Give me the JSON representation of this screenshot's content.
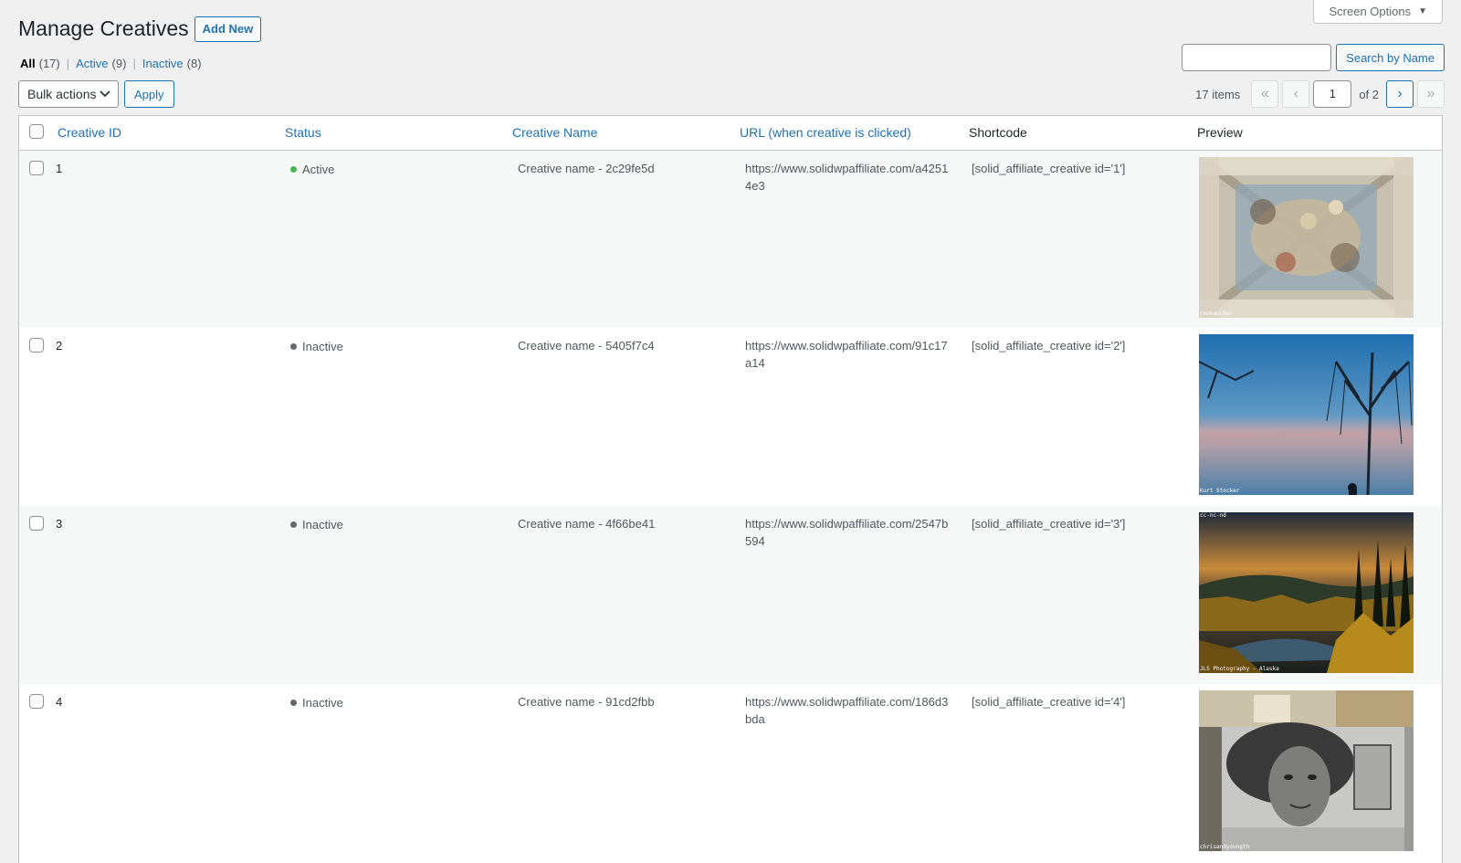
{
  "header": {
    "title": "Manage Creatives",
    "add_new": "Add New",
    "screen_options": "Screen Options",
    "screen_options_arrow": "▼"
  },
  "filters": {
    "all": {
      "label": "All",
      "count": "(17)"
    },
    "active": {
      "label": "Active",
      "count": "(9)"
    },
    "inactive": {
      "label": "Inactive",
      "count": "(8)"
    },
    "separator": "|"
  },
  "search": {
    "value": "",
    "button": "Search by Name"
  },
  "bulk": {
    "selected": "Bulk actions",
    "apply": "Apply"
  },
  "pagination": {
    "items": "17 items",
    "first": "«",
    "prev": "‹",
    "current": "1",
    "of": "of 2",
    "next": "›",
    "last": "»"
  },
  "columns": {
    "id": "Creative ID",
    "status": "Status",
    "name": "Creative Name",
    "url": "URL (when creative is clicked)",
    "shortcode": "Shortcode",
    "preview": "Preview"
  },
  "colors": {
    "active": "#46b450",
    "inactive": "#646970",
    "link": "#2271b1"
  },
  "rows": [
    {
      "id": "1",
      "status": "Active",
      "name": "Creative name - 2c29fe5d",
      "url": "https://www.solidwpaffiliate.com/a42514e3",
      "shortcode": "[solid_affiliate_creative id='1']",
      "preview_caption": "ceokaucher"
    },
    {
      "id": "2",
      "status": "Inactive",
      "name": "Creative name - 5405f7c4",
      "url": "https://www.solidwpaffiliate.com/91c17a14",
      "shortcode": "[solid_affiliate_creative id='2']",
      "preview_caption": "Kurt Stocker"
    },
    {
      "id": "3",
      "status": "Inactive",
      "name": "Creative name - 4f66be41",
      "url": "https://www.solidwpaffiliate.com/2547b594",
      "shortcode": "[solid_affiliate_creative id='3']",
      "preview_caption": "JLS Photography - Alaska"
    },
    {
      "id": "4",
      "status": "Inactive",
      "name": "Creative name - 91cd2fbb",
      "url": "https://www.solidwpaffiliate.com/186d3bda",
      "shortcode": "[solid_affiliate_creative id='4']",
      "preview_caption": "chrisandyoungth"
    }
  ]
}
